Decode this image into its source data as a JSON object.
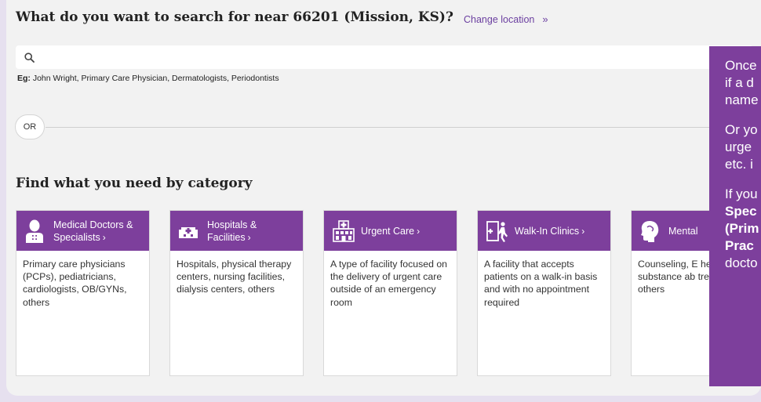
{
  "header": {
    "question": "What do you want to search for near 66201 (Mission, KS)?",
    "change_location": "Change location",
    "change_arrows": "»"
  },
  "search": {
    "value": "",
    "placeholder": "",
    "example_label": "Eg:",
    "example_text": "John Wright, Primary Care Physician, Dermatologists, Periodontists"
  },
  "divider": {
    "or_label": "OR"
  },
  "categories_heading": "Find what you need by category",
  "categories": [
    {
      "label": "Medical Doctors & Specialists",
      "chevron": "›",
      "icon": "doctor-icon",
      "description": "Primary care physicians (PCPs), pediatricians, cardiologists, OB/GYNs, others"
    },
    {
      "label": "Hospitals & Facilities",
      "chevron": "›",
      "icon": "hospital-icon",
      "description": "Hospitals, physical therapy centers, nursing facilities, dialysis centers, others"
    },
    {
      "label": "Urgent Care",
      "chevron": "›",
      "icon": "urgent-care-icon",
      "description": "A type of facility focused on the delivery of urgent care outside of an emergency room"
    },
    {
      "label": "Walk-In Clinics",
      "chevron": "›",
      "icon": "walk-in-icon",
      "description": "A facility that accepts patients on a walk-in basis and with no appointment required"
    },
    {
      "label": "Mental",
      "chevron": "",
      "icon": "mental-health-icon",
      "description": "Counseling, E health faciliti substance ab treatment, ps others"
    }
  ],
  "overlay": {
    "p1_line1": "Once",
    "p1_line2": "if a d",
    "p1_line3": "name",
    "p2_line1": "Or yo",
    "p2_line2": "urge",
    "p2_line3": "etc. i",
    "p3_line1": "If you",
    "p3_line2": "Spec",
    "p3_line3": "(Prim",
    "p3_line4": "Prac",
    "p3_line5": "docto"
  },
  "colors": {
    "brand_purple": "#7d3f9c",
    "link_purple": "#6b3fa0",
    "page_bg": "#f2f2f2"
  }
}
